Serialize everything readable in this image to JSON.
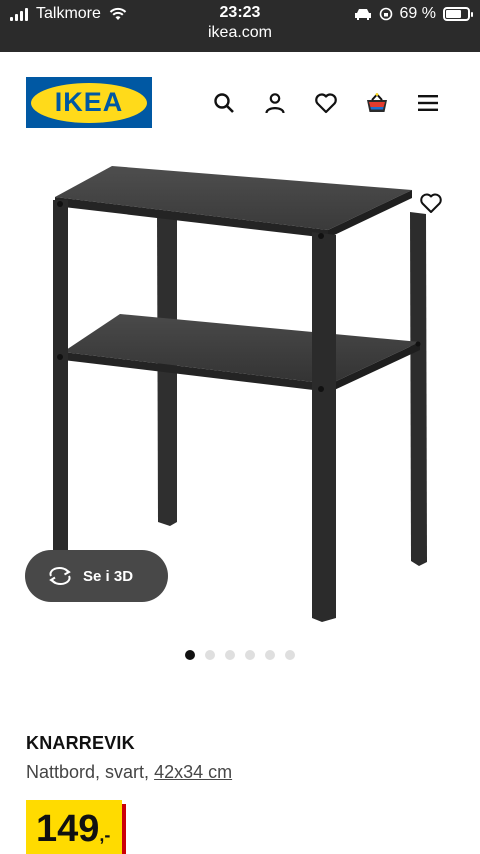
{
  "status": {
    "carrier": "Talkmore",
    "time": "23:23",
    "url": "ikea.com",
    "battery": "69 %"
  },
  "header": {
    "logo": "IKEA",
    "icons": [
      "search-icon",
      "user-icon",
      "heart-icon",
      "cart-icon",
      "menu-icon"
    ]
  },
  "gallery": {
    "view3d_label": "Se i 3D",
    "dots_total": 6,
    "active_index": 0
  },
  "product": {
    "name": "KNARREVIK",
    "description": "Nattbord, svart,",
    "size": "42x34 cm",
    "price": "149",
    "price_suffix": ",-"
  },
  "colors": {
    "ikea_blue": "#0058a3",
    "ikea_yellow": "#ffda1a",
    "price_red": "#cc0008",
    "statusbar": "#2b2b2b",
    "button_dark": "#484848"
  }
}
